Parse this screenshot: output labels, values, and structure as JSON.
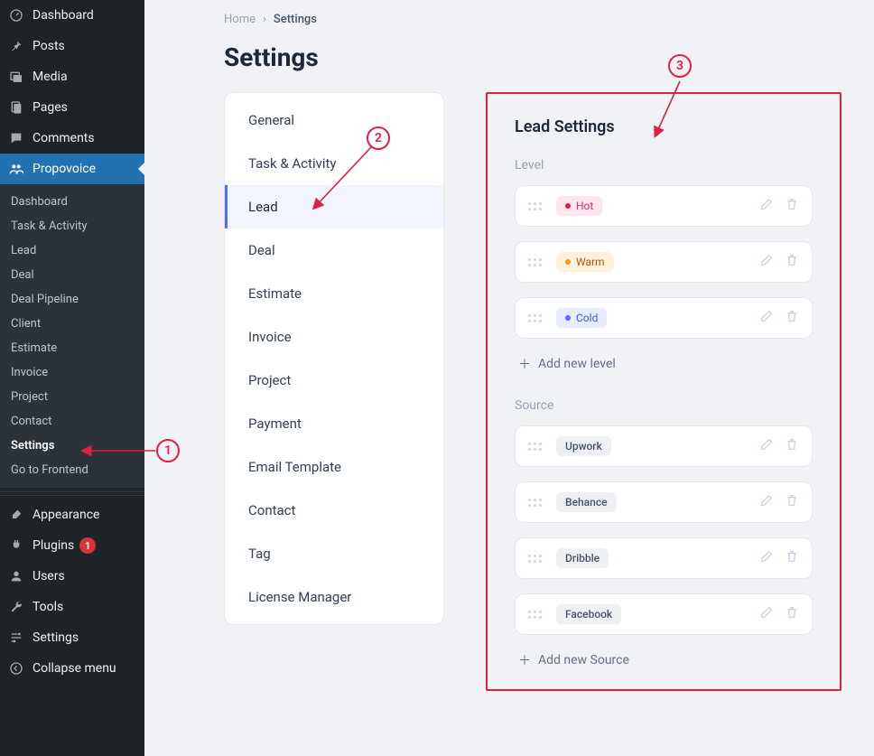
{
  "wp_sidebar": {
    "items_top": [
      {
        "label": "Dashboard",
        "icon": "dashboard"
      },
      {
        "label": "Posts",
        "icon": "pin"
      },
      {
        "label": "Media",
        "icon": "media"
      },
      {
        "label": "Pages",
        "icon": "pages"
      },
      {
        "label": "Comments",
        "icon": "comments"
      }
    ],
    "active": {
      "label": "Propovoice",
      "icon": "group"
    },
    "submenu": [
      "Dashboard",
      "Task & Activity",
      "Lead",
      "Deal",
      "Deal Pipeline",
      "Client",
      "Estimate",
      "Invoice",
      "Project",
      "Contact",
      "Settings",
      "Go to Frontend"
    ],
    "submenu_current": "Settings",
    "items_bottom": [
      {
        "label": "Appearance",
        "icon": "brush"
      },
      {
        "label": "Plugins",
        "icon": "plug",
        "badge": "1"
      },
      {
        "label": "Users",
        "icon": "user"
      },
      {
        "label": "Tools",
        "icon": "wrench"
      },
      {
        "label": "Settings",
        "icon": "sliders"
      },
      {
        "label": "Collapse menu",
        "icon": "collapse"
      }
    ]
  },
  "breadcrumb": {
    "home": "Home",
    "current": "Settings"
  },
  "page_title": "Settings",
  "settings_nav": [
    "General",
    "Task & Activity",
    "Lead",
    "Deal",
    "Estimate",
    "Invoice",
    "Project",
    "Payment",
    "Email Template",
    "Contact",
    "Tag",
    "License Manager"
  ],
  "settings_nav_active": "Lead",
  "panel": {
    "title": "Lead Settings",
    "level_label": "Level",
    "levels": [
      {
        "name": "Hot",
        "variant": "hot"
      },
      {
        "name": "Warm",
        "variant": "warm"
      },
      {
        "name": "Cold",
        "variant": "cold"
      }
    ],
    "add_level": "Add new level",
    "source_label": "Source",
    "sources": [
      "Upwork",
      "Behance",
      "Dribble",
      "Facebook"
    ],
    "add_source": "Add new Source"
  },
  "annotations": {
    "1": "1",
    "2": "2",
    "3": "3"
  }
}
